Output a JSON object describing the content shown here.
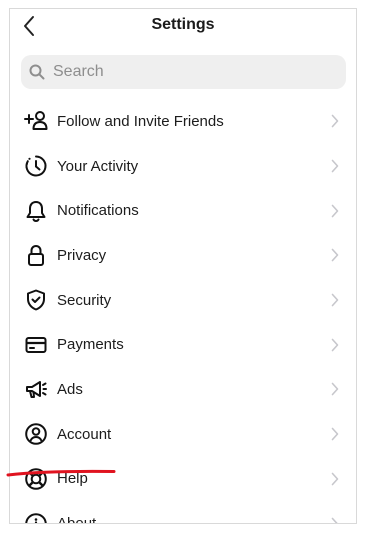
{
  "header": {
    "title": "Settings",
    "back_icon": "chevron-left-icon"
  },
  "search": {
    "placeholder": "Search",
    "value": "",
    "icon": "search-icon"
  },
  "menu": [
    {
      "label": "Follow and Invite Friends",
      "icon": "add-person-icon"
    },
    {
      "label": "Your Activity",
      "icon": "activity-clock-icon"
    },
    {
      "label": "Notifications",
      "icon": "bell-icon"
    },
    {
      "label": "Privacy",
      "icon": "lock-icon"
    },
    {
      "label": "Security",
      "icon": "shield-check-icon"
    },
    {
      "label": "Payments",
      "icon": "credit-card-icon"
    },
    {
      "label": "Ads",
      "icon": "megaphone-icon"
    },
    {
      "label": "Account",
      "icon": "user-circle-icon"
    },
    {
      "label": "Help",
      "icon": "lifebuoy-icon"
    },
    {
      "label": "About",
      "icon": "info-icon"
    }
  ],
  "annotation": {
    "highlighted_item": "Help",
    "color": "#e0131f"
  },
  "colors": {
    "chevron": "#c7c7cc",
    "search_bg": "#efefef",
    "placeholder": "#8e8e8e"
  }
}
